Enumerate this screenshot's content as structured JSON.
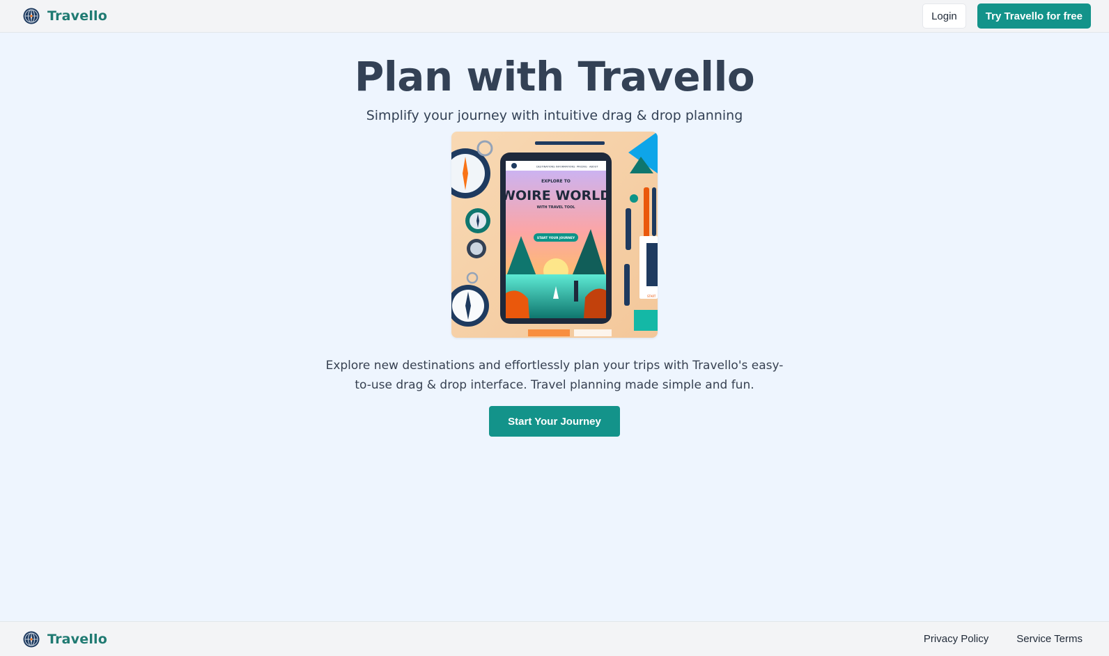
{
  "header": {
    "logo_icon": "globe-compass-icon",
    "brand": "Travello",
    "login_label": "Login",
    "cta_label": "Try Travello for free"
  },
  "hero": {
    "title": "Plan with Travello",
    "subtitle": "Simplify your journey with intuitive drag & drop planning",
    "illustration": {
      "nav_items": [
        "DESTINATIONS",
        "INFORMATIONS",
        "PRICING",
        "ABOUT"
      ],
      "eyebrow": "EXPLORE TO",
      "headline": "WOIRE WORLD",
      "tagline": "WITH TRAVEL TOOL",
      "button": "START YOUR JOURNEY",
      "side_card_text": "START"
    },
    "description": "Explore new destinations and effortlessly plan your trips with Travello's easy-to-use drag & drop interface. Travel planning made simple and fun.",
    "start_label": "Start Your Journey"
  },
  "footer": {
    "brand": "Travello",
    "links": [
      "Privacy Policy",
      "Service Terms"
    ]
  },
  "colors": {
    "accent": "#13938a",
    "brand_text": "#1f7a72",
    "background": "#eef5fe",
    "bar_background": "#f3f4f6"
  }
}
